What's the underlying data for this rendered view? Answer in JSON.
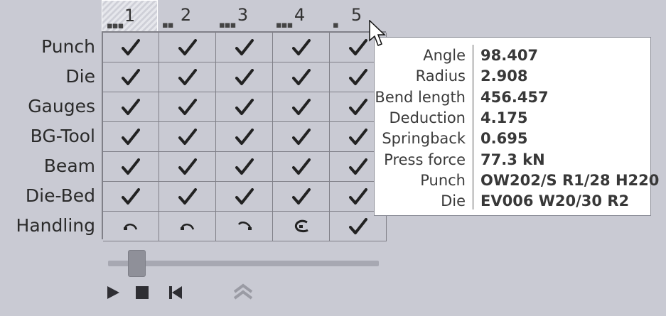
{
  "columns": [
    {
      "number": "1",
      "dots": "▪▪▪",
      "active": true
    },
    {
      "number": "2",
      "dots": "▪▪",
      "active": false
    },
    {
      "number": "3",
      "dots": "▪▪▪",
      "active": false
    },
    {
      "number": "4",
      "dots": "▪▪▪",
      "active": false
    },
    {
      "number": "5",
      "dots": "▪",
      "active": false
    }
  ],
  "rows": [
    {
      "label": "Punch",
      "cells": [
        "check",
        "check",
        "check",
        "check",
        "check"
      ]
    },
    {
      "label": "Die",
      "cells": [
        "check",
        "check",
        "check",
        "check",
        "check"
      ]
    },
    {
      "label": "Gauges",
      "cells": [
        "check",
        "check",
        "check",
        "check",
        "check"
      ]
    },
    {
      "label": "BG-Tool",
      "cells": [
        "check",
        "check",
        "check",
        "check",
        "check"
      ]
    },
    {
      "label": "Beam",
      "cells": [
        "check",
        "check",
        "check",
        "check",
        "check"
      ]
    },
    {
      "label": "Die-Bed",
      "cells": [
        "check",
        "check",
        "check",
        "check",
        "check"
      ]
    },
    {
      "label": "Handling",
      "cells": [
        "rotate-left-icon",
        "rotate-left-icon",
        "rotate-right-icon",
        "turn-over-icon",
        "check"
      ]
    }
  ],
  "slider": {
    "position_fraction": 0.08
  },
  "playback": {
    "buttons": [
      "play-icon",
      "stop-icon",
      "skip-back-icon",
      "collapse-up-icon"
    ]
  },
  "tooltip": {
    "items": [
      {
        "key": "Angle",
        "value": "98.407"
      },
      {
        "key": "Radius",
        "value": "2.908"
      },
      {
        "key": "Bend length",
        "value": "456.457"
      },
      {
        "key": "Deduction",
        "value": "4.175"
      },
      {
        "key": "Springback",
        "value": "0.695"
      },
      {
        "key": "Press force",
        "value": "77.3 kN"
      },
      {
        "key": "Punch",
        "value": "OW202/S R1/28 H220"
      },
      {
        "key": "Die",
        "value": "EV006 W20/30 R2"
      }
    ]
  },
  "colors": {
    "background": "#c9cad3",
    "grid_line": "#808088",
    "tooltip_bg": "#ffffff"
  }
}
